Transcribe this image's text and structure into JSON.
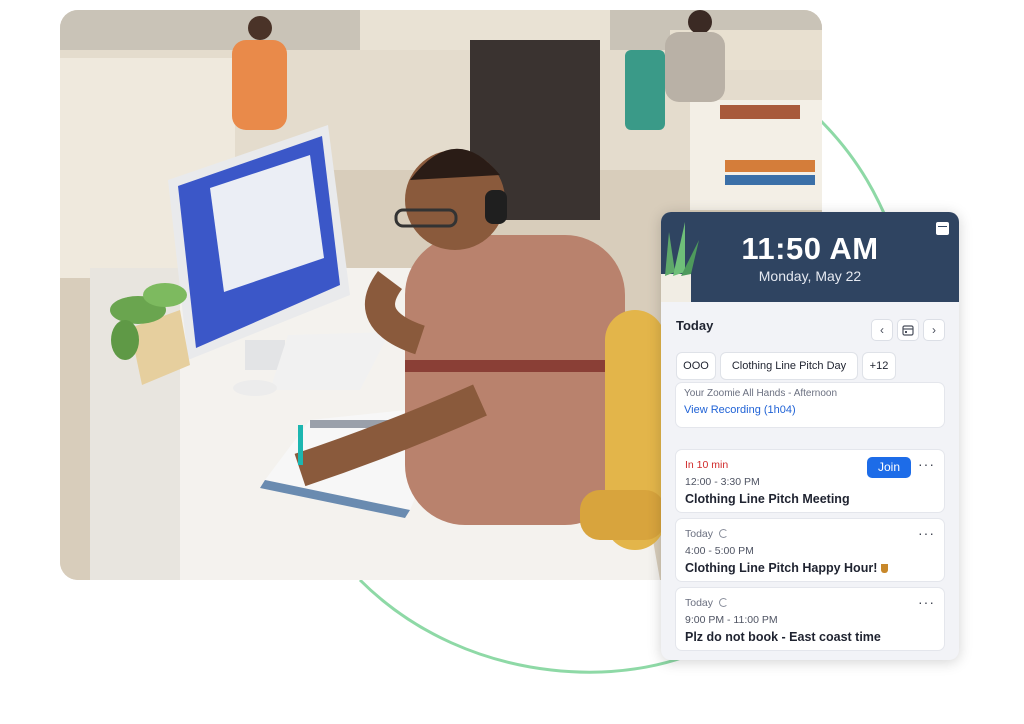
{
  "widget": {
    "clock": {
      "time": "11:50 AM",
      "date": "Monday, May 22"
    },
    "toolbar": {
      "label": "Today",
      "prev_icon": "chevron-left-icon",
      "calendar_icon": "calendar-icon",
      "next_icon": "chevron-right-icon"
    },
    "chips": [
      {
        "label": "OOO"
      },
      {
        "label": "Clothing Line Pitch Day"
      },
      {
        "label": "+12"
      }
    ],
    "partial_event": {
      "title": "Your Zoomie All Hands - Afternoon",
      "link": "View Recording (1h04)"
    },
    "events": [
      {
        "status": "In 10 min",
        "time": "12:00 - 3:30 PM",
        "title": "Clothing Line Pitch Meeting",
        "action": "Join",
        "more": "···"
      },
      {
        "status": "Today",
        "time": "4:00 - 5:00 PM",
        "title": "Clothing Line Pitch Happy Hour!",
        "more": "···"
      },
      {
        "status": "Today",
        "time": "9:00 PM - 11:00 PM",
        "title": "Plz do not book - East coast time",
        "more": "···"
      }
    ]
  },
  "colors": {
    "header_bg": "#2f4461",
    "accent": "#1d6ce8",
    "alert": "#d02a2a",
    "arc": "#8ed9a6"
  }
}
